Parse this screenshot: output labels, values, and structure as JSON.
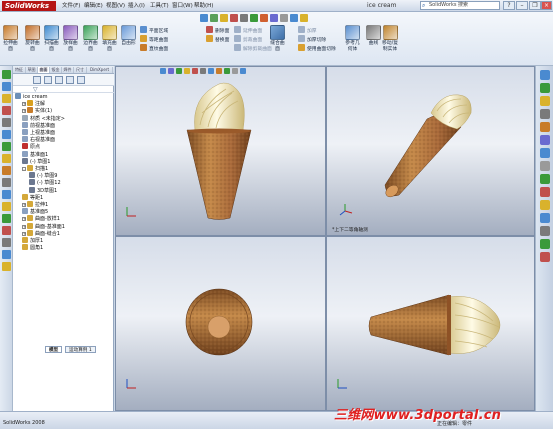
{
  "app": {
    "name": "SolidWorks",
    "document_title": "ice cream",
    "version_text": "SolidWorks 2008"
  },
  "menu": [
    "文件(F)",
    "编辑(E)",
    "视图(V)",
    "插入(I)",
    "工具(T)",
    "窗口(W)",
    "帮助(H)"
  ],
  "search": {
    "text": "SolidWorks 搜索"
  },
  "commands": {
    "main": [
      {
        "label": "拉伸曲\n面",
        "color": "#c77b2c"
      },
      {
        "label": "旋转曲\n面",
        "color": "#c26e2a"
      },
      {
        "label": "扫描曲\n面",
        "color": "#3f8bd0"
      },
      {
        "label": "放样曲\n面",
        "color": "#8a5bbd"
      },
      {
        "label": "边界曲\n面",
        "color": "#3ba35a"
      },
      {
        "label": "填充曲\n面",
        "color": "#d9b22c"
      },
      {
        "label": "自由形",
        "color": "#6a9ad8"
      }
    ],
    "col1": [
      "平面区域",
      "等距曲面",
      "直纹曲面"
    ],
    "col2": [
      "删除面",
      "替换面"
    ],
    "col3": [
      "延伸曲面",
      "剪裁曲面",
      "解除剪裁曲面"
    ],
    "col4": {
      "big": "缝合曲\n面",
      "items": [
        "加厚",
        "加厚切除",
        "使用曲面切除"
      ]
    },
    "right": [
      {
        "label": "参考几\n何体",
        "color": "#5a8fcf"
      },
      {
        "label": "曲线",
        "color": "#7a7a7a"
      },
      {
        "label": "移动/复\n制实体",
        "color": "#c0852f"
      }
    ]
  },
  "feature_manager": {
    "tabs": [
      "特征",
      "草图",
      "曲面",
      "钣金",
      "焊件",
      "尺寸",
      "DimXpert"
    ],
    "bottom_tabs": [
      "模型",
      "运动算例 1"
    ],
    "tree": [
      {
        "text": "ice cream",
        "level": 0,
        "expander": "",
        "icon": "#6b8fb8"
      },
      {
        "text": "注解",
        "level": 1,
        "expander": "+",
        "icon": "#d8a020"
      },
      {
        "text": "实体(1)",
        "level": 1,
        "expander": "+",
        "icon": "#c87c2a"
      },
      {
        "text": "材质 <未指定>",
        "level": 1,
        "expander": "",
        "icon": "#9aa8b8"
      },
      {
        "text": "前视基准面",
        "level": 1,
        "expander": "",
        "icon": "#8aa0c0"
      },
      {
        "text": "上视基准面",
        "level": 1,
        "expander": "",
        "icon": "#8aa0c0"
      },
      {
        "text": "右视基准面",
        "level": 1,
        "expander": "",
        "icon": "#8aa0c0"
      },
      {
        "text": "原点",
        "level": 1,
        "expander": "",
        "icon": "#c03030"
      },
      {
        "text": "基准面1",
        "level": 1,
        "expander": "",
        "icon": "#8aa0c0"
      },
      {
        "text": "(-) 草图1",
        "level": 1,
        "expander": "",
        "icon": "#6c7890"
      },
      {
        "text": "扫描1",
        "level": 1,
        "expander": "-",
        "icon": "#d4a83a"
      },
      {
        "text": "(-) 草图9",
        "level": 2,
        "expander": "",
        "icon": "#6c7890"
      },
      {
        "text": "(-) 草图12",
        "level": 2,
        "expander": "",
        "icon": "#6c7890"
      },
      {
        "text": "3D草图1",
        "level": 2,
        "expander": "",
        "icon": "#6c7890"
      },
      {
        "text": "等距1",
        "level": 1,
        "expander": "",
        "icon": "#d4a83a"
      },
      {
        "text": "拉伸1",
        "level": 1,
        "expander": "+",
        "icon": "#d4a83a"
      },
      {
        "text": "基准面5",
        "level": 1,
        "expander": "",
        "icon": "#8aa0c0"
      },
      {
        "text": "曲面-放样1",
        "level": 1,
        "expander": "+",
        "icon": "#d4a83a"
      },
      {
        "text": "曲面-基准面1",
        "level": 1,
        "expander": "+",
        "icon": "#d4a83a"
      },
      {
        "text": "曲面-缝合1",
        "level": 1,
        "expander": "+",
        "icon": "#d4a83a"
      },
      {
        "text": "加厚1",
        "level": 1,
        "expander": "",
        "icon": "#d4a83a"
      },
      {
        "text": "圆角1",
        "level": 1,
        "expander": "",
        "icon": "#d4a83a"
      }
    ]
  },
  "viewports": {
    "top_right_label": "*上下二等角轴测"
  },
  "status": {
    "right_text": "正在编辑：零件"
  },
  "watermark": "三维网www.3dportal.cn",
  "colors": {
    "cone": "#a86a32",
    "cream": "#f3e9c2",
    "accent": "#b51414"
  }
}
